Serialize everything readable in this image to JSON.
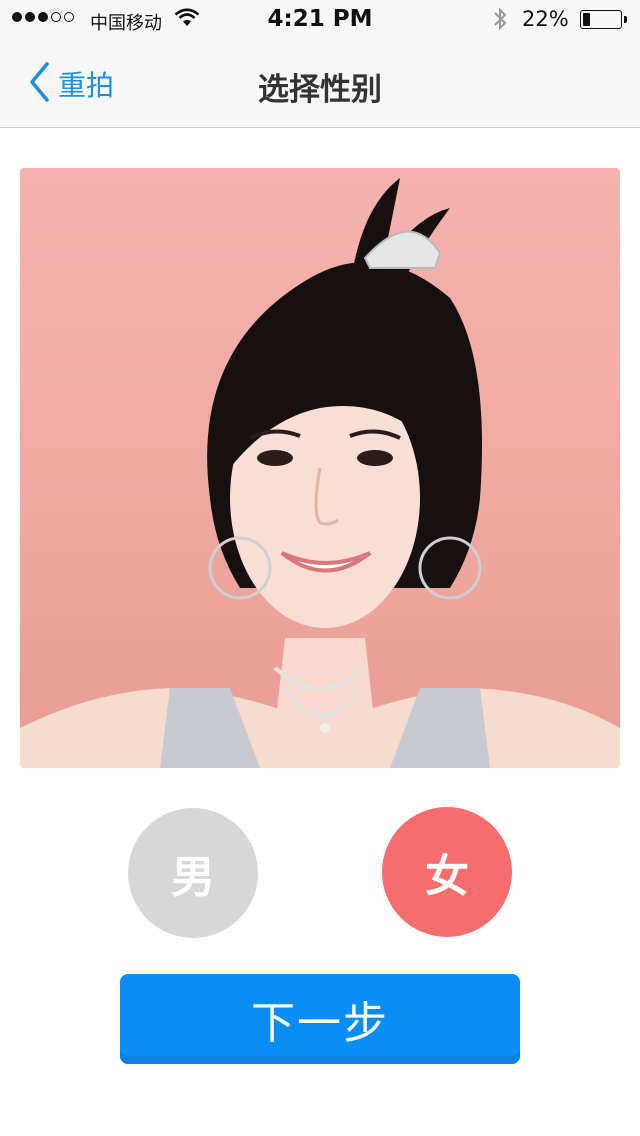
{
  "status_bar": {
    "carrier": "中国移动",
    "time": "4:21 PM",
    "battery_percent": "22%",
    "battery_level": 0.22,
    "signal_bars_filled": 3,
    "signal_bars_total": 5
  },
  "nav": {
    "back_label": "重拍",
    "title": "选择性别"
  },
  "photo": {
    "subject": "portrait photo"
  },
  "gender": {
    "male_label": "男",
    "female_label": "女",
    "selected": "female",
    "selected_color": "#f56d6d",
    "unselected_color": "#d7d7d7"
  },
  "actions": {
    "next_label": "下一步",
    "accent_color": "#0a8ef6"
  }
}
